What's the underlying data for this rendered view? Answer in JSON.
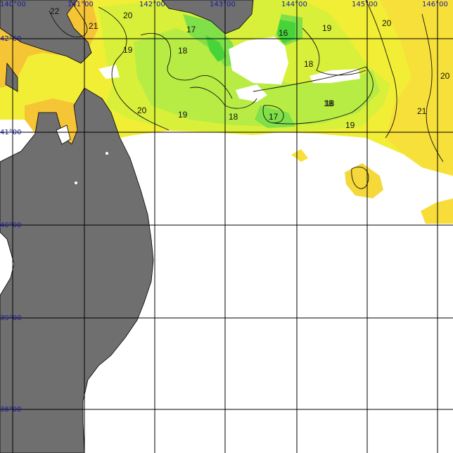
{
  "map": {
    "longitude_labels": [
      "140°00",
      "141°00",
      "142°00",
      "143°00",
      "144°00",
      "145°00",
      "146°00"
    ],
    "latitude_labels": [
      "42°00",
      "41°00",
      "40°00",
      "39°00",
      "38°00"
    ],
    "contour_labels": [
      "22",
      "21",
      "20",
      "17",
      "16",
      "19",
      "20",
      "19",
      "18",
      "18",
      "20",
      "18",
      "18",
      "20",
      "19",
      "18",
      "17",
      "21",
      "19"
    ],
    "colors": {
      "land": "#6f6f6f",
      "no_data": "#ffffff",
      "sst_16": "#47d43a",
      "sst_17": "#7fe04a",
      "sst_18": "#b7ec45",
      "sst_19": "#d9f03a",
      "sst_20": "#f2ee36",
      "sst_21": "#f7e03a",
      "sst_22": "#f5c535"
    }
  }
}
